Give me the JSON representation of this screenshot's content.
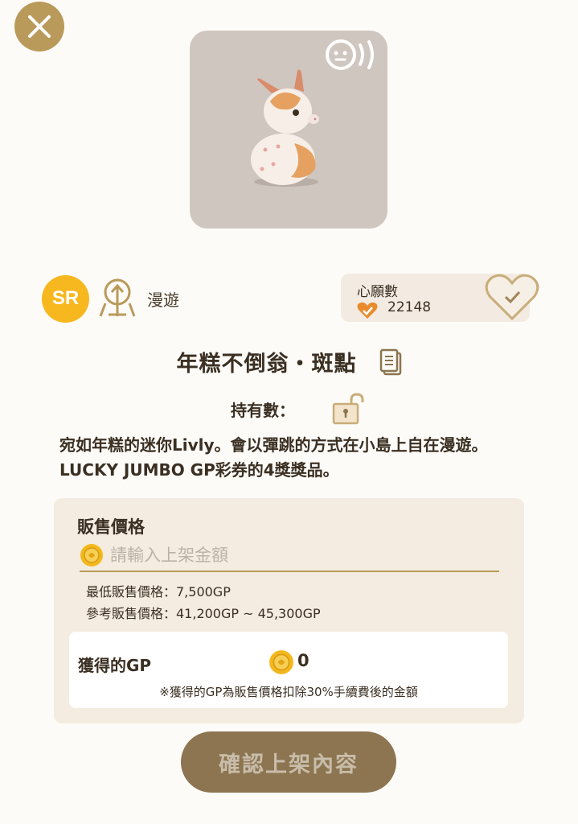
{
  "header": {
    "close_icon": "close-icon"
  },
  "pet": {
    "image": "rice-cake-tumbler-pet",
    "voice_icon": "voice-sound-icon",
    "rarity": "SR",
    "behavior_icon": "roam-icon",
    "behavior": "漫遊",
    "name": "年糕不倒翁・斑點",
    "owned_label": "持有數：",
    "description": "宛如年糕的迷你Livly。會以彈跳的方式在小島上自在漫遊。LUCKY JUMBO GP彩券的4獎獎品。"
  },
  "wishlist": {
    "title": "心願數",
    "count": "22148",
    "heart_icon": "heart-icon",
    "add_icon": "heart-check-icon"
  },
  "sale": {
    "title": "販售價格",
    "input_placeholder": "請輸入上架金額",
    "input_value": "",
    "min_price": "最低販售價格：7,500GP",
    "ref_price": "參考販售價格：41,200GP ~ 45,300GP",
    "earn_label": "獲得的GP",
    "earn_value": "0",
    "note": "※獲得的GP為販售價格扣除30%手續費後的金額"
  },
  "confirm_label": "確認上架內容",
  "colors": {
    "accent": "#b99a5a",
    "rarity": "#f7b71e",
    "button": "#8c7550",
    "panel": "#f4ece0"
  }
}
